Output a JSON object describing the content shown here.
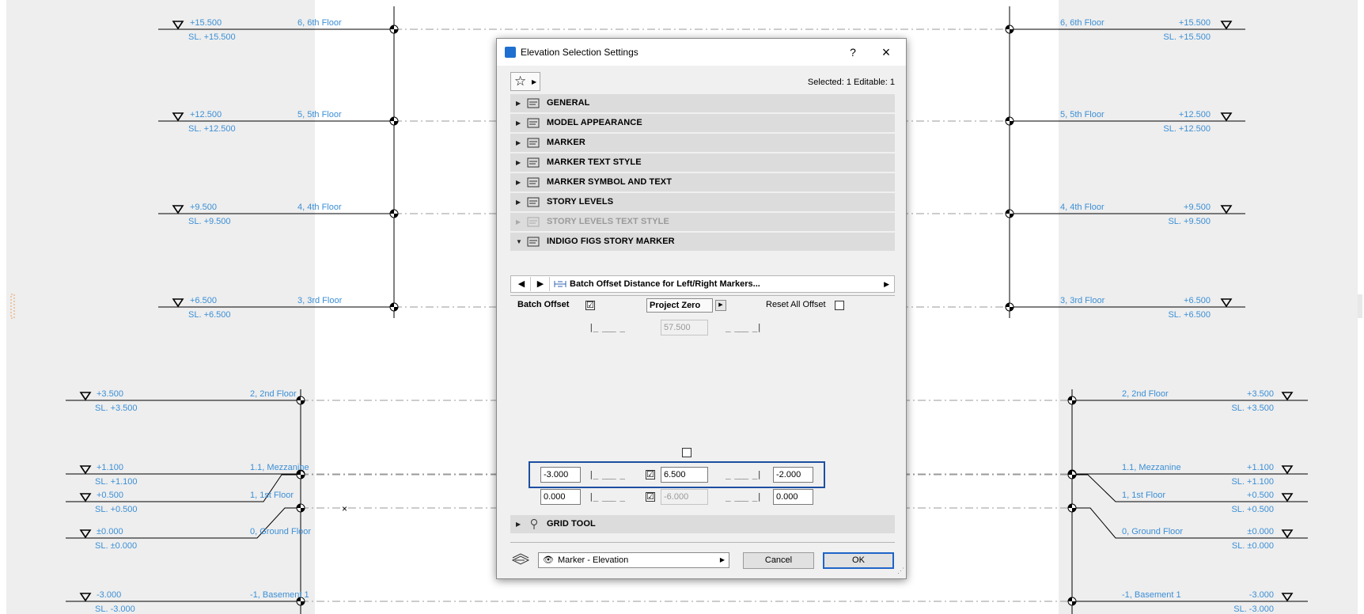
{
  "drawing": {
    "levels_left": [
      {
        "elev": "+15.500",
        "sl": "SL. +15.500",
        "story": "6,  6th Floor"
      },
      {
        "elev": "+12.500",
        "sl": "SL. +12.500",
        "story": "5,  5th Floor"
      },
      {
        "elev": "+9.500",
        "sl": "SL. +9.500",
        "story": "4,  4th Floor"
      },
      {
        "elev": "+6.500",
        "sl": "SL. +6.500",
        "story": "3,  3rd Floor"
      },
      {
        "elev": "+3.500",
        "sl": "SL. +3.500",
        "story": "2,  2nd Floor"
      },
      {
        "elev": "+1.100",
        "sl": "SL. +1.100",
        "story": "1.1,  Mezzanine"
      },
      {
        "elev": "+0.500",
        "sl": "SL. +0.500",
        "story": "1,  1st Floor"
      },
      {
        "elev": "±0.000",
        "sl": "SL. ±0.000",
        "story": "0,  Ground Floor"
      },
      {
        "elev": "-3.000",
        "sl": "SL. -3.000",
        "story": "-1,  Basement 1"
      }
    ],
    "marker_color": "#3b8fd6",
    "line_color": "#000000",
    "band_color": "#eeeeee"
  },
  "dialog": {
    "title": "Elevation Selection Settings",
    "help": "?",
    "close": "×",
    "favorites_icon": "star-icon",
    "selected_info": "Selected: 1 Editable: 1",
    "panels": [
      {
        "label": "GENERAL",
        "icon": "general-settings-icon",
        "expanded": false,
        "enabled": true
      },
      {
        "label": "MODEL APPEARANCE",
        "icon": "model-appearance-icon",
        "expanded": false,
        "enabled": true
      },
      {
        "label": "MARKER",
        "icon": "marker-icon",
        "expanded": false,
        "enabled": true
      },
      {
        "label": "MARKER TEXT STYLE",
        "icon": "marker-text-style-icon",
        "expanded": false,
        "enabled": true
      },
      {
        "label": "MARKER SYMBOL AND TEXT",
        "icon": "marker-symbol-text-icon",
        "expanded": false,
        "enabled": true
      },
      {
        "label": "STORY LEVELS",
        "icon": "story-levels-icon",
        "expanded": false,
        "enabled": true
      },
      {
        "label": "STORY LEVELS TEXT STYLE",
        "icon": "story-levels-text-style-icon",
        "expanded": false,
        "enabled": false
      },
      {
        "label": "INDIGO FIGS STORY MARKER",
        "icon": "indigo-figs-marker-icon",
        "expanded": true,
        "enabled": true
      }
    ],
    "page": {
      "prev": "◀",
      "next": "▶",
      "title": "Batch Offset Distance for Left/Right Markers...",
      "more": "▶"
    },
    "batch_offset": {
      "label": "Batch Offset",
      "checked": "☑",
      "reference": "Project Zero",
      "reset_label": "Reset All Offset",
      "left_symbol": "|_ ___ _",
      "right_symbol": "_ ___ _|",
      "value": "57.500"
    },
    "rows": [
      {
        "left": "-3.000",
        "mid_checked": "☑",
        "mid": "6.500",
        "right": "-2.000"
      },
      {
        "left": "0.000",
        "mid_checked": "☑",
        "mid": "-6.000",
        "right": "0.000"
      }
    ],
    "grid_tool": {
      "label": "GRID TOOL",
      "icon": "grid-tool-icon"
    },
    "footer": {
      "layer_icon": "layers-icon",
      "layer_value": "Marker - Elevation",
      "cancel": "Cancel",
      "ok": "OK"
    }
  }
}
